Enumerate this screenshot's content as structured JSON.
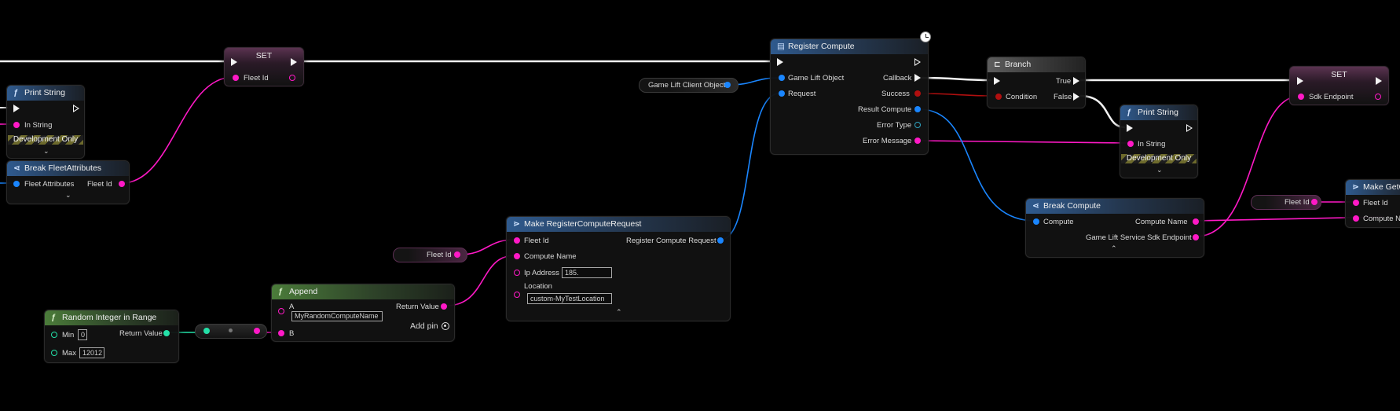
{
  "nodes": {
    "print_string_1": {
      "title": "Print String",
      "in_string": "In String",
      "dev_only": "Development Only"
    },
    "break_fleet": {
      "title": "Break FleetAttributes",
      "fleet_attributes": "Fleet Attributes",
      "fleet_id": "Fleet Id"
    },
    "set_1": {
      "title": "SET",
      "fleet_id": "Fleet Id"
    },
    "register_compute": {
      "title": "Register Compute",
      "game_lift_object": "Game Lift Object",
      "request": "Request",
      "callback": "Callback",
      "success": "Success",
      "result_compute": "Result Compute",
      "error_type": "Error Type",
      "error_message": "Error Message"
    },
    "game_lift_client_reroute": {
      "label": "Game Lift Client Object"
    },
    "branch": {
      "title": "Branch",
      "condition": "Condition",
      "true": "True",
      "false": "False"
    },
    "print_string_2": {
      "title": "Print String",
      "in_string": "In String",
      "dev_only": "Development Only"
    },
    "set_2": {
      "title": "SET",
      "sdk_endpoint": "Sdk Endpoint"
    },
    "break_compute": {
      "title": "Break Compute",
      "compute": "Compute",
      "compute_name": "Compute Name",
      "sdk_endpoint": "Game Lift Service Sdk Endpoint"
    },
    "fleet_id_reroute_right": {
      "label": "Fleet Id"
    },
    "make_getc": {
      "title": "Make GetC",
      "fleet_id": "Fleet Id",
      "compute_name": "Compute Na"
    },
    "make_register": {
      "title": "Make RegisterComputeRequest",
      "fleet_id": "Fleet Id",
      "compute_name": "Compute Name",
      "ip_address": "Ip Address",
      "ip_value": "185.",
      "location": "Location",
      "location_value": "custom-MyTestLocation",
      "out": "Register Compute Request"
    },
    "fleet_id_reroute_left": {
      "label": "Fleet Id"
    },
    "append": {
      "title": "Append",
      "a": "A",
      "a_value": "MyRandomComputeName",
      "b": "B",
      "return_value": "Return Value",
      "add_pin": "Add pin"
    },
    "random_int": {
      "title": "Random Integer in Range",
      "min": "Min",
      "min_value": "0",
      "max": "Max",
      "max_value": "12012",
      "return_value": "Return Value"
    }
  },
  "colors": {
    "string_pin": "#ff19c6",
    "object_pin": "#1a86ff",
    "int_pin": "#24e0a8",
    "bool_pin": "#b10f0f",
    "exec_wire": "#f2f2f2"
  }
}
